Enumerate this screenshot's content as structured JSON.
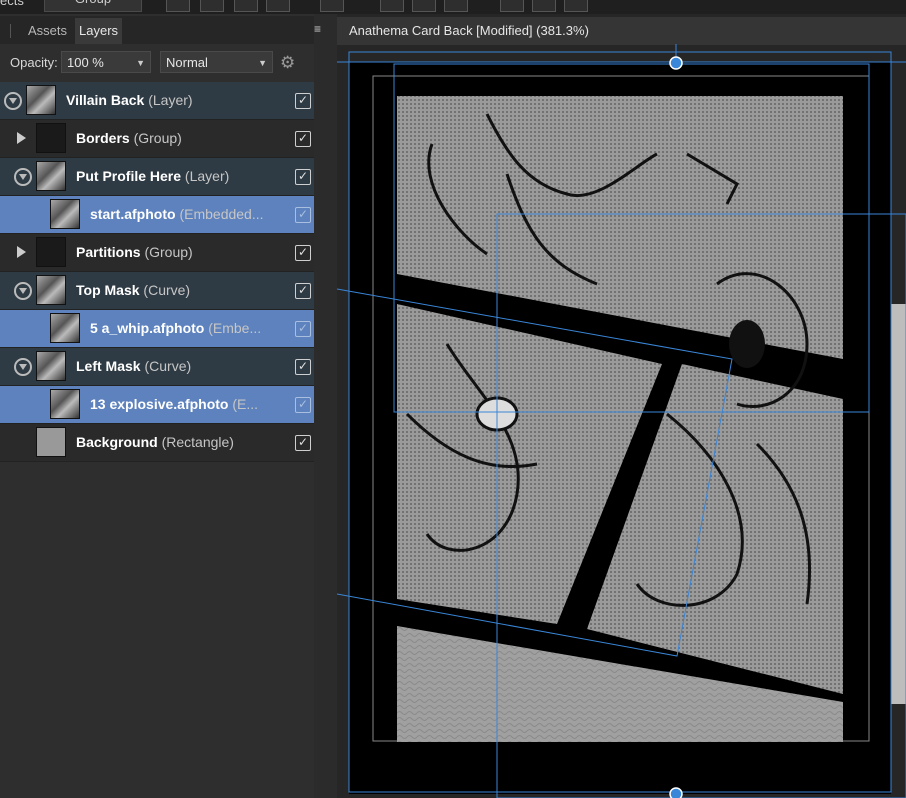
{
  "toolbar": {
    "left_fragment": "ects",
    "group_label": "Group"
  },
  "panel": {
    "tabs": [
      {
        "label": "Assets",
        "active": false
      },
      {
        "label": "Layers",
        "active": true
      }
    ],
    "opacity_label": "Opacity:",
    "opacity_value": "100 %",
    "blend_mode": "Normal"
  },
  "layers": [
    {
      "name": "Villain Back",
      "type": "(Layer)",
      "indent": 0,
      "expanded": true,
      "parent": true,
      "selected": false,
      "visible": true,
      "thumb": "sketch"
    },
    {
      "name": "Borders",
      "type": "(Group)",
      "indent": 1,
      "expanded": false,
      "parent": false,
      "selected": false,
      "visible": true,
      "thumb": "dark"
    },
    {
      "name": "Put Profile Here",
      "type": "(Layer)",
      "indent": 1,
      "expanded": true,
      "parent": true,
      "selected": false,
      "visible": true,
      "thumb": "sketch"
    },
    {
      "name": "start.afphoto",
      "type": "(Embedded...",
      "indent": 2,
      "expanded": null,
      "parent": false,
      "selected": true,
      "visible": true,
      "thumb": "sketch"
    },
    {
      "name": "Partitions",
      "type": "(Group)",
      "indent": 1,
      "expanded": false,
      "parent": false,
      "selected": false,
      "visible": true,
      "thumb": "dark"
    },
    {
      "name": "Top Mask",
      "type": "(Curve)",
      "indent": 1,
      "expanded": true,
      "parent": true,
      "selected": false,
      "visible": true,
      "thumb": "sketch"
    },
    {
      "name": "5 a_whip.afphoto",
      "type": "(Embe...",
      "indent": 2,
      "expanded": null,
      "parent": false,
      "selected": true,
      "visible": true,
      "thumb": "sketch"
    },
    {
      "name": "Left Mask",
      "type": "(Curve)",
      "indent": 1,
      "expanded": true,
      "parent": true,
      "selected": false,
      "visible": true,
      "thumb": "sketch"
    },
    {
      "name": "13 explosive.afphoto",
      "type": "(E...",
      "indent": 2,
      "expanded": null,
      "parent": false,
      "selected": true,
      "visible": true,
      "thumb": "sketch"
    },
    {
      "name": "Background",
      "type": "(Rectangle)",
      "indent": 1,
      "expanded": null,
      "parent": false,
      "selected": false,
      "visible": true,
      "thumb": "gray"
    }
  ],
  "document": {
    "title": "Anathema Card Back [Modified] (381.3%)"
  },
  "colors": {
    "selection": "#5d82bd",
    "guide": "#3a86d8"
  }
}
